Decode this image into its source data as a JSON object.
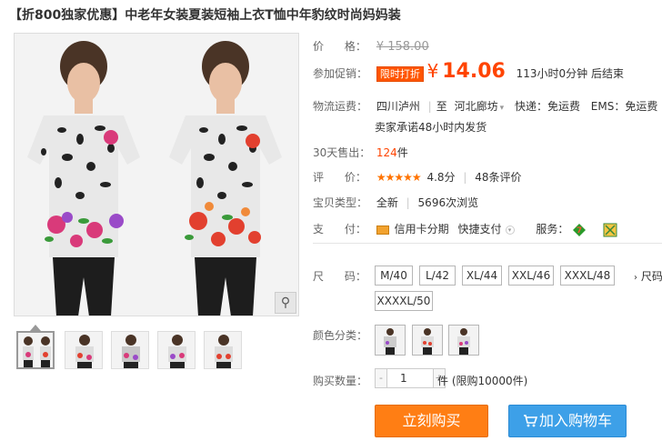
{
  "title": "【折800独家优惠】中老年女装夏装短袖上衣T恤中年豹纹时尚妈妈装",
  "price": {
    "label": "价      格：",
    "original": "¥ 158.00"
  },
  "promo": {
    "label": "参加促销：",
    "badge": "限时打折",
    "currency": "¥",
    "amount": "14.06",
    "countdown": "113小时0分钟 后结束"
  },
  "shipping": {
    "label": "物流运费：",
    "from": "四川泸州",
    "to_prefix": "至",
    "to": "河北廊坊",
    "express": "快递：免运费",
    "ems": "EMS：免运费",
    "promise": "卖家承诺48小时内发货"
  },
  "sales": {
    "label": "30天售出：",
    "count": "124",
    "unit": "件"
  },
  "rating": {
    "label": "评      价：",
    "stars": "★★★★★",
    "score": "4.8分",
    "reviews": "48条评价"
  },
  "item_type": {
    "label": "宝贝类型：",
    "condition": "全新",
    "views": "5696次浏览"
  },
  "payment": {
    "label": "支      付：",
    "credit": "信用卡分期",
    "quick": "快捷支付",
    "service_label": "服务："
  },
  "size": {
    "label": "尺      码：",
    "options": [
      "M/40",
      "L/42",
      "XL/44",
      "XXL/46",
      "XXXL/48",
      "XXXXL/50"
    ],
    "more": "尺码"
  },
  "color": {
    "label": "颜色分类："
  },
  "quantity": {
    "label": "购买数量：",
    "value": "1",
    "minus": "-",
    "plus": "+",
    "unit": "件 (限购10000件)"
  },
  "buttons": {
    "buy": "立刻购买",
    "cart": "加入购物车"
  },
  "colors": {
    "accent": "#ff4400",
    "buy_bg": "#ff7e14",
    "cart_bg": "#3da0e8"
  },
  "icons": {
    "zoom": "magnifier-icon",
    "cart": "cart-icon",
    "card": "credit-card-icon"
  }
}
